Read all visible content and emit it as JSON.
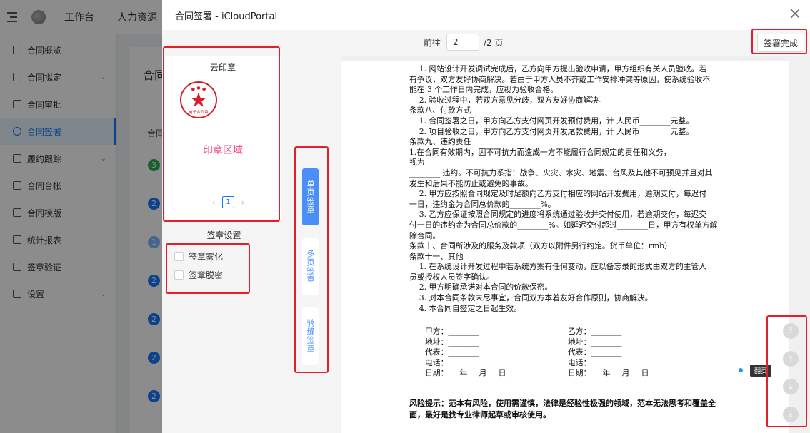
{
  "background_app": {
    "top_nav": [
      "工作台",
      "人力资源"
    ],
    "sidebar": [
      {
        "label": "合同概览"
      },
      {
        "label": "合同拟定",
        "chevron": "⌄"
      },
      {
        "label": "合同审批"
      },
      {
        "label": "合同签署",
        "active": true
      },
      {
        "label": "履约跟踪",
        "chevron": "⌄"
      },
      {
        "label": "合同台帐"
      },
      {
        "label": "合同模版"
      },
      {
        "label": "统计报表"
      },
      {
        "label": "签章验证"
      },
      {
        "label": "设置",
        "chevron": "⌄"
      }
    ],
    "main_title": "合同",
    "column_header": "合同",
    "row_numbers": [
      "3",
      "2",
      "1",
      "2",
      "2",
      "2",
      "2"
    ]
  },
  "dialog": {
    "title": "合同签署 - iCloudPortal",
    "pager": {
      "prefix": "前往",
      "current": "2",
      "suffix": "/2 页"
    },
    "finish_label": "签署完成"
  },
  "seal_panel": {
    "title": "云印章",
    "seal_text": "电子合同章",
    "seal_area_label": "印章区域",
    "page": "1",
    "prev": "‹",
    "next": "›"
  },
  "sign_settings": {
    "title": "签章设置",
    "options": [
      "签章雾化",
      "签章脱密"
    ]
  },
  "sign_modes": [
    {
      "label": "单页签章",
      "active": true
    },
    {
      "label": "多页签章",
      "active": false
    },
    {
      "label": "骑缝签章",
      "active": false
    }
  ],
  "document": {
    "lines": [
      "    1. 网站设计开发调试完成后，乙方向甲方提出验收申请，甲方组织有关人员验收。若",
      "有争议，双方友好协商解决。若由于甲方人员不齐或工作安排冲突等原因，使系统验收不",
      "能在 3 个工作日内完成，应视为验收合格。",
      "    2. 验收过程中，若双方意见分歧，双方友好协商解决。",
      "条款八、付款方式",
      "    1. 合同签署之日，甲方向乙方支付网页开发预付费用，计 人民币________元整。",
      "    2. 项目验收之日，甲方向乙方支付网页开发尾款费用，计 人民币________元整。",
      "条款九、违约责任",
      "1.在合同有效期内，因不可抗力而造成一方不能履行合同规定的责任和义务，",
      "视为",
      "________ 违约。不可抗力系指：战争、火灾、水灾、地震、台风及其他不可预见并且对其",
      "发生和后果不能防止或避免的事故。",
      "    2. 甲方应按照合同规定及时足额向乙方支付相应的网站开发费用，逾期支付，每迟付",
      "一日，违约金为合同总价款的________%。",
      "    3. 乙方应保证按照合同规定的进度将系统通过验收并交付使用，若逾期交付，每迟交",
      "付一日的违约金为合同总价款的________%。如延迟交付超过________日，甲方有权单方解",
      "除合同。",
      "条款十、合同所涉及的服务及款项（双方以附件另行约定。货币单位：rmb）",
      "条款十一、其他",
      "    1. 在系统设计开发过程中若系统方案有任何变动，应以备忘录的形式由双方的主管人",
      "员或授权人员签字确认。",
      "    2. 甲方明确承诺对本合同的价款保密。",
      "    3. 对本合同条款未尽事宜，合同双方本着友好合作原则，协商解决。",
      "    4. 本合同自签定之日起生效。"
    ],
    "party_a": [
      "甲方：________",
      "地址：________",
      "代表：________",
      "电话：________",
      "日期：___年___月___日"
    ],
    "party_b": [
      "乙方：________",
      "地址：________",
      "代表：________",
      "电话：________",
      "日期：___年___月___日"
    ],
    "risk": "风险提示：范本有风险，使用需谨慎，法律是经验性极强的领域，范本无法思考和覆盖全面，最好是找专业律师起草或审核使用。"
  },
  "page_tip": "翻页",
  "colors": {
    "accent": "#1677ff",
    "annotation": "#e0202a",
    "seal": "#d4202a",
    "seal_area": "#f0508c"
  }
}
